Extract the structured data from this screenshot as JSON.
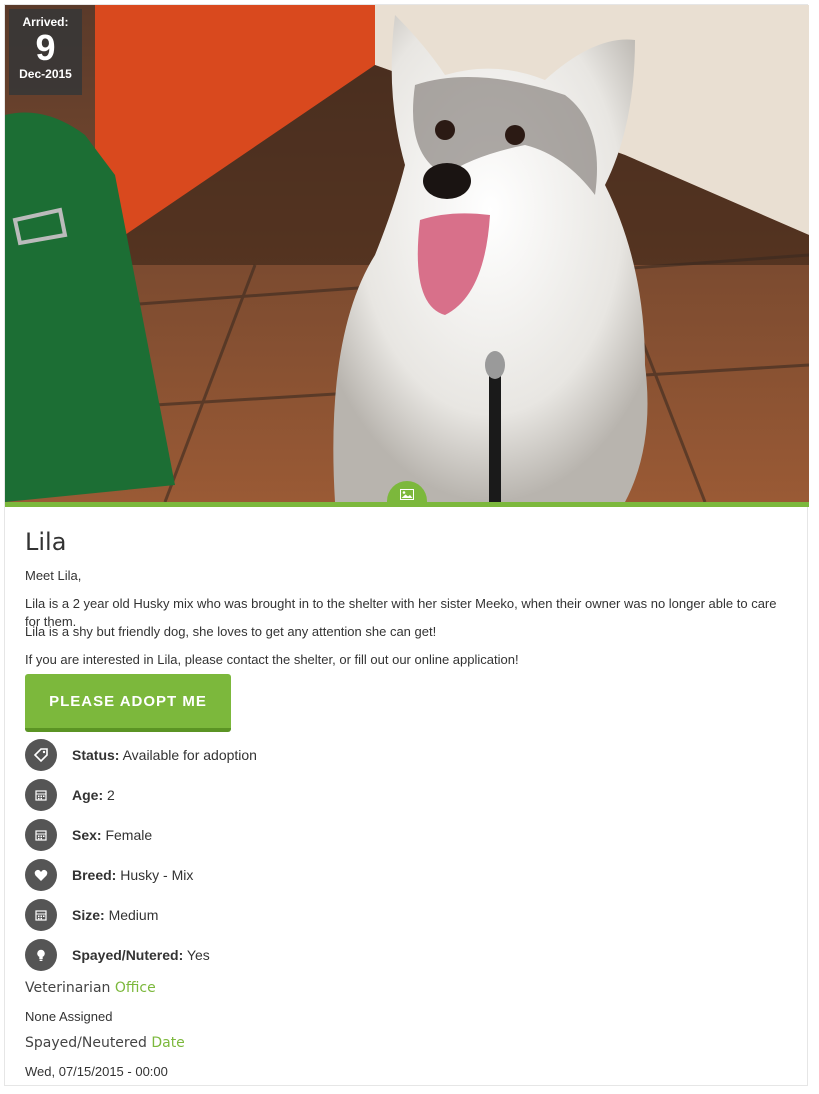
{
  "arrived": {
    "label": "Arrived:",
    "day": "9",
    "month_year": "Dec-2015"
  },
  "pet": {
    "name": "Lila",
    "description": [
      "Meet Lila,",
      "Lila is a 2 year old Husky mix who was brought in to the shelter with her sister Meeko, when their owner was no longer able to care for them.",
      "Lila is a shy but friendly dog, she loves to get any attention she can get!",
      "If you are interested in Lila, please contact the shelter, or fill out our online application!"
    ],
    "adopt_label": "PLEASE ADOPT ME",
    "attributes": [
      {
        "label": "Status:",
        "value": " Available for adoption",
        "icon": "tag-icon"
      },
      {
        "label": "Age:",
        "value": " 2",
        "icon": "calendar-icon"
      },
      {
        "label": "Sex:",
        "value": " Female",
        "icon": "calendar-icon"
      },
      {
        "label": "Breed:",
        "value": " Husky - Mix",
        "icon": "heart-icon"
      },
      {
        "label": "Size:",
        "value": " Medium",
        "icon": "calendar-icon"
      },
      {
        "label": "Spayed/Nutered:",
        "value": " Yes",
        "icon": "lightbulb-icon"
      }
    ],
    "vet_office": {
      "heading": "Veterinarian",
      "heading_accent": "Office",
      "value": "None Assigned"
    },
    "spay_date": {
      "heading": "Spayed/Neutered",
      "heading_accent": "Date",
      "value": "Wed, 07/15/2015 - 00:00"
    }
  },
  "colors": {
    "accent": "#7cb83c",
    "icon_bg": "#555555"
  }
}
